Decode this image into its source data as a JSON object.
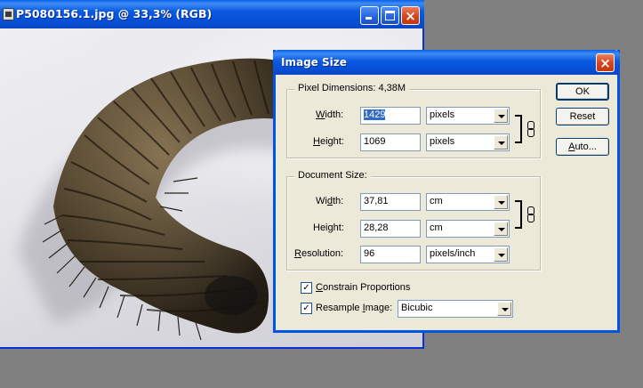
{
  "document_window": {
    "title": "P5080156.1.jpg @ 33,3% (RGB)",
    "icon": "photoshop-document-icon",
    "controls": {
      "minimize": "minimize-icon",
      "maximize": "maximize-icon",
      "close": "×"
    }
  },
  "dialog": {
    "title": "Image Size",
    "close_glyph": "×",
    "pixel_dimensions": {
      "legend": "Pixel Dimensions:",
      "size_value": "4,38M",
      "width": {
        "label_ul": "W",
        "label_rest": "idth:",
        "value": "1429",
        "unit": "pixels"
      },
      "height": {
        "label_ul": "H",
        "label_rest": "eight:",
        "value": "1069",
        "unit": "pixels"
      }
    },
    "document_size": {
      "legend": "Document Size:",
      "width": {
        "label_pre": "Wi",
        "label_ul": "d",
        "label_rest": "th:",
        "value": "37,81",
        "unit": "cm"
      },
      "height": {
        "label_pre": "Hei",
        "label_ul": "g",
        "label_rest": "ht:",
        "value": "28,28",
        "unit": "cm"
      },
      "resolution": {
        "label_ul": "R",
        "label_rest": "esolution:",
        "value": "96",
        "unit": "pixels/inch"
      }
    },
    "constrain": {
      "label_ul": "C",
      "label_rest": "onstrain Proportions",
      "checked": true
    },
    "resample": {
      "label_pre": "Resample ",
      "label_ul": "I",
      "label_rest": "mage:",
      "checked": true,
      "method": "Bicubic"
    },
    "buttons": {
      "ok": "OK",
      "reset": "Reset",
      "auto_ul": "A",
      "auto_rest": "uto..."
    }
  },
  "colors": {
    "xp_blue": "#0054e3",
    "dialog_bg": "#ece9d8",
    "selection": "#316ac5",
    "desktop": "#808080"
  }
}
